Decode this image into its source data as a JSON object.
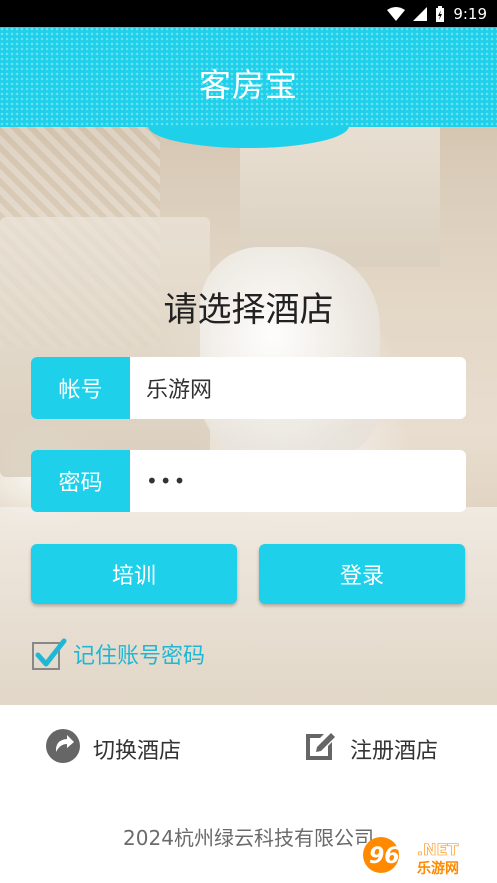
{
  "status_bar": {
    "time": "9:19",
    "icons": [
      "wifi-icon",
      "signal-icon",
      "battery-charging-icon"
    ]
  },
  "header": {
    "title": "客房宝",
    "color": "#1fd0ea"
  },
  "login": {
    "hotel_prompt": "请选择酒店",
    "account_label": "帐号",
    "account_value": "乐游网",
    "password_label": "密码",
    "password_value": "•••",
    "train_button": "培训",
    "login_button": "登录",
    "remember_label": "记住账号密码",
    "remember_checked": true
  },
  "footer": {
    "switch_hotel": "切换酒店",
    "register_hotel": "注册酒店",
    "copyright": "2024杭州绿云科技有限公司"
  },
  "watermark": {
    "number": "962",
    "suffix": ".NET",
    "site": "乐游网"
  },
  "colors": {
    "accent": "#1fd0ea",
    "remember_text": "#1fb7d6"
  }
}
